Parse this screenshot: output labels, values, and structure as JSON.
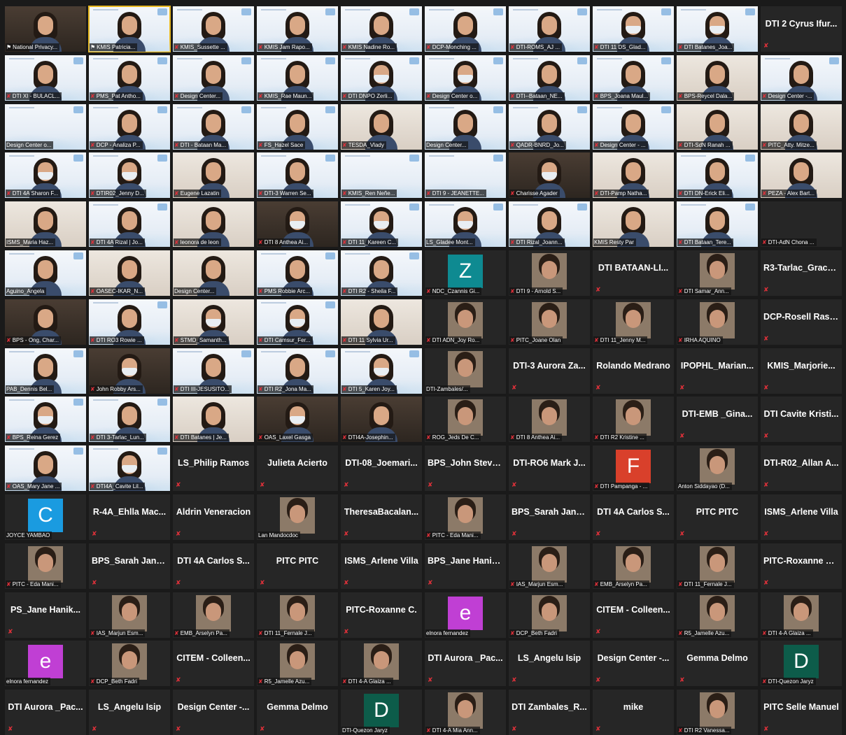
{
  "colors": {
    "background": "#1a1a1a",
    "tile": "#262626",
    "active_speaker": "#e8b820",
    "muted": "#e0313a",
    "tag_text": "#ffffff"
  },
  "icons": {
    "muted": "✘",
    "pinned": "⚑"
  },
  "participants": [
    {
      "name": "National Privacy...",
      "type": "video",
      "pinned": true,
      "muted": false,
      "style": "dark"
    },
    {
      "name": "KMIS Patricia...",
      "type": "video",
      "pinned": true,
      "muted": false,
      "active": true
    },
    {
      "name": "KMIS_Sussette ...",
      "type": "video",
      "muted": true
    },
    {
      "name": "KMIS Jam Rapo...",
      "type": "video",
      "muted": true
    },
    {
      "name": "KMIS Nadine Ro...",
      "type": "video",
      "muted": true
    },
    {
      "name": "DCP-Monching ...",
      "type": "video",
      "muted": true
    },
    {
      "name": "DTI-ROMS_AJ ...",
      "type": "video",
      "muted": true
    },
    {
      "name": "DTI 11 DS_Glad...",
      "type": "video",
      "muted": true,
      "mask": true
    },
    {
      "name": "DTI Batanes_Joa...",
      "type": "video",
      "muted": true,
      "mask": true
    },
    {
      "name": "DTI 2 Cyrus Ifur...",
      "type": "name",
      "muted": true
    },
    {
      "name": "DTI XI - BULACL...",
      "type": "video",
      "muted": true
    },
    {
      "name": "PMS_Pat Antho...",
      "type": "video",
      "muted": true
    },
    {
      "name": "Design Center...",
      "type": "video",
      "muted": true
    },
    {
      "name": "KMIS_Rae Maun...",
      "type": "video",
      "muted": true
    },
    {
      "name": "DTI DNPO Zerli...",
      "type": "video",
      "muted": true,
      "mask": true
    },
    {
      "name": "Design Center o...",
      "type": "video",
      "muted": true,
      "mask": true
    },
    {
      "name": "DTI--Bataan_NE...",
      "type": "video",
      "muted": true
    },
    {
      "name": "BPS_Joana Maul...",
      "type": "video",
      "muted": true
    },
    {
      "name": "BPS-Reycel Dala...",
      "type": "video",
      "muted": true,
      "style": "alt"
    },
    {
      "name": "Design Center -...",
      "type": "video",
      "muted": true
    },
    {
      "name": "Design Center o...",
      "type": "video",
      "muted": false,
      "noperson": true
    },
    {
      "name": "DCP - Analiza P...",
      "type": "video",
      "muted": true
    },
    {
      "name": "DTI - Bataan Ma...",
      "type": "video",
      "muted": true
    },
    {
      "name": "FS_Hazel Sace",
      "type": "video",
      "muted": true
    },
    {
      "name": "TESDA_Vlady",
      "type": "video",
      "muted": true,
      "style": "alt"
    },
    {
      "name": "Design Center...",
      "type": "video",
      "muted": false
    },
    {
      "name": "QADR-BNRD_Jo...",
      "type": "video",
      "muted": true
    },
    {
      "name": "Design Center - ...",
      "type": "video",
      "muted": true
    },
    {
      "name": "DTI-SdN Ranah ...",
      "type": "video",
      "muted": true,
      "style": "alt"
    },
    {
      "name": "PITC_Atty. Mitze...",
      "type": "video",
      "muted": true,
      "style": "alt"
    },
    {
      "name": "DTI 4A Sharon F...",
      "type": "video",
      "muted": true,
      "mask": true
    },
    {
      "name": "DTIR02_Jenny D...",
      "type": "video",
      "muted": true,
      "mask": true
    },
    {
      "name": "Eugene Lazatin",
      "type": "video",
      "muted": true,
      "style": "alt"
    },
    {
      "name": "DTI-3 Warren Se...",
      "type": "video",
      "muted": true
    },
    {
      "name": "KMIS_Ren Neñe...",
      "type": "video",
      "muted": true,
      "noperson": true
    },
    {
      "name": "DTI 9 - JEANETTE...",
      "type": "video",
      "muted": true,
      "noperson": true
    },
    {
      "name": "Charisse Agader",
      "type": "video",
      "muted": true,
      "style": "dark",
      "mask": true
    },
    {
      "name": "DTI-Pamp Natha...",
      "type": "video",
      "muted": true,
      "style": "alt"
    },
    {
      "name": "DTI DN-Erick Eli...",
      "type": "video",
      "muted": true
    },
    {
      "name": "PEZA - Alex Bart...",
      "type": "video",
      "muted": true,
      "style": "alt"
    },
    {
      "name": "ISMS_Maria Haz...",
      "type": "video",
      "muted": false,
      "style": "alt"
    },
    {
      "name": "DTI 4A Rizal | Jo...",
      "type": "video",
      "muted": true
    },
    {
      "name": "leonora de leon",
      "type": "video",
      "muted": true,
      "style": "alt"
    },
    {
      "name": "DTI 8 Anthea Ai...",
      "type": "video",
      "muted": true,
      "style": "dark",
      "mask": true
    },
    {
      "name": "DTI 11_Kareen C...",
      "type": "video",
      "muted": true,
      "mask": true
    },
    {
      "name": "LS_Gladee Mont...",
      "type": "video",
      "muted": false,
      "mask": true
    },
    {
      "name": "DTI Rizal_Joann...",
      "type": "video",
      "muted": true
    },
    {
      "name": "KMIS Resty Par",
      "type": "video",
      "muted": false,
      "style": "alt"
    },
    {
      "name": "DTI Bataan_Tere...",
      "type": "video",
      "muted": true
    },
    {
      "name": "DTI-AdN Chona ...",
      "type": "empty",
      "muted": true
    },
    {
      "name": "Aguino_Angela",
      "type": "video",
      "muted": false
    },
    {
      "name": "OASEC-IKAR_N...",
      "type": "video",
      "muted": true,
      "style": "alt"
    },
    {
      "name": "Design Center...",
      "type": "video",
      "muted": false,
      "style": "alt"
    },
    {
      "name": "PMS Robbie Arc...",
      "type": "video",
      "muted": true
    },
    {
      "name": "DTI R2 - Sheila F...",
      "type": "video",
      "muted": true
    },
    {
      "name": "NDC_Czannis Gi...",
      "type": "avatar",
      "letter": "Z",
      "avatarColor": "#0e8a91",
      "muted": true
    },
    {
      "name": "DTI 9 - Arnold S...",
      "type": "photo",
      "muted": true
    },
    {
      "name": "DTI BATAAN-LI...",
      "type": "name",
      "muted": true
    },
    {
      "name": "DTI Samar_Ann...",
      "type": "photo",
      "muted": true
    },
    {
      "name": "R3-Tarlac_Grace...",
      "type": "name",
      "muted": true
    },
    {
      "name": "BPS - Ong, Char...",
      "type": "video",
      "muted": true,
      "style": "dark"
    },
    {
      "name": "DTI RO3 Rowie ...",
      "type": "video",
      "muted": true
    },
    {
      "name": "STMD_Samanth...",
      "type": "video",
      "muted": true,
      "style": "alt",
      "mask": true
    },
    {
      "name": "DTI Camsur_Fer...",
      "type": "video",
      "muted": true,
      "mask": true
    },
    {
      "name": "DTI 11 Sylvia Ur...",
      "type": "video",
      "muted": true,
      "style": "alt"
    },
    {
      "name": "DTI ADN_Joy Ro...",
      "type": "photo",
      "muted": true
    },
    {
      "name": "PITC_Joane Olan",
      "type": "photo",
      "muted": true
    },
    {
      "name": "DTI 11_Jenny M...",
      "type": "photo",
      "muted": true
    },
    {
      "name": "IRHA AQUINO",
      "type": "photo",
      "muted": true
    },
    {
      "name": "DCP-Rosell Rasos",
      "type": "name",
      "muted": true
    },
    {
      "name": "PAB_Dennis Bel...",
      "type": "video",
      "muted": false
    },
    {
      "name": "John Robby Ars...",
      "type": "video",
      "muted": true,
      "style": "dark",
      "mask": true
    },
    {
      "name": "DTI III-JESUSITO...",
      "type": "video",
      "muted": true
    },
    {
      "name": "DTI R2_Jona Ma...",
      "type": "video",
      "muted": true
    },
    {
      "name": "DTI 5_Karen Joy...",
      "type": "video",
      "muted": true,
      "mask": true
    },
    {
      "name": "DTI-Zambales/...",
      "type": "photo",
      "muted": false
    },
    {
      "name": "DTI-3 Aurora Za...",
      "type": "name",
      "muted": true
    },
    {
      "name": "Rolando Medrano",
      "type": "name",
      "muted": true
    },
    {
      "name": "IPOPHL_Marian...",
      "type": "name",
      "muted": true
    },
    {
      "name": "KMIS_Marjorie...",
      "type": "name",
      "muted": true
    },
    {
      "name": "BPS_Reina Gerez",
      "type": "video",
      "muted": true,
      "mask": true
    },
    {
      "name": "DTI 3-Tarlac_Lun...",
      "type": "video",
      "muted": true
    },
    {
      "name": "DTI Batanes | Je...",
      "type": "video",
      "muted": true,
      "style": "alt"
    },
    {
      "name": "OAS_Laxel Gasga",
      "type": "video",
      "muted": true,
      "style": "dark",
      "mask": true
    },
    {
      "name": "DTI4A-Josephin...",
      "type": "video",
      "muted": true,
      "style": "dark"
    },
    {
      "name": "ROG_Jeds De C...",
      "type": "photo",
      "muted": true
    },
    {
      "name": "DTI 8 Anthea Ai...",
      "type": "photo",
      "muted": true
    },
    {
      "name": "DTI R2 Kristine ...",
      "type": "photo",
      "muted": true
    },
    {
      "name": "DTI-EMB _Gina...",
      "type": "name",
      "muted": true
    },
    {
      "name": "DTI Cavite Kristi...",
      "type": "name",
      "muted": true
    },
    {
      "name": "OAS_Mary Jane ...",
      "type": "video",
      "muted": true
    },
    {
      "name": "DTI4A_Cavite Lil...",
      "type": "video",
      "muted": true,
      "mask": true
    },
    {
      "name": "LS_Philip Ramos",
      "type": "name",
      "muted": true
    },
    {
      "name": "Julieta Acierto",
      "type": "name",
      "muted": true
    },
    {
      "name": "DTI-08_Joemari...",
      "type": "name",
      "muted": true
    },
    {
      "name": "BPS_John Steve...",
      "type": "name",
      "muted": true
    },
    {
      "name": "DTI-RO6 Mark J...",
      "type": "name",
      "muted": true
    },
    {
      "name": "DTI Pampanga - ...",
      "type": "avatar",
      "letter": "F",
      "avatarColor": "#d9402b",
      "muted": true
    },
    {
      "name": "Anton Siddayao (D...",
      "type": "photo",
      "muted": false
    },
    {
      "name": "DTI-R02_Allan A...",
      "type": "name",
      "muted": true
    },
    {
      "name": "JOYCE YAMBAO",
      "type": "avatar",
      "letter": "C",
      "avatarColor": "#1a9be0",
      "muted": false
    },
    {
      "name": "R-4A_Ehlla Mac...",
      "type": "name",
      "muted": true
    },
    {
      "name": "Aldrin Veneracion",
      "type": "name",
      "muted": true
    },
    {
      "name": "Lan Mandocdoc",
      "type": "photo",
      "muted": false
    },
    {
      "name": "TheresaBacalan...",
      "type": "name",
      "muted": true
    },
    {
      "name": "PITC - Eda Mani...",
      "type": "photo",
      "muted": true
    },
    {
      "name": "BPS_Sarah Jane...",
      "type": "name",
      "muted": true
    },
    {
      "name": "DTI 4A Carlos S...",
      "type": "name",
      "muted": true
    },
    {
      "name": "PITC PITC",
      "type": "name",
      "muted": true
    },
    {
      "name": "ISMS_Arlene Villa",
      "type": "name",
      "muted": true
    },
    {
      "name": "PITC - Eda Mani...",
      "type": "photo",
      "muted": true
    },
    {
      "name": "BPS_Sarah Jane...",
      "type": "name",
      "muted": true
    },
    {
      "name": "DTI 4A Carlos S...",
      "type": "name",
      "muted": true
    },
    {
      "name": "PITC PITC",
      "type": "name",
      "muted": true
    },
    {
      "name": "ISMS_Arlene Villa",
      "type": "name",
      "muted": true
    },
    {
      "name": "BPS_Jane Hanik...",
      "type": "name",
      "muted": true
    },
    {
      "name": "IAS_Marjun Esm...",
      "type": "photo",
      "muted": true
    },
    {
      "name": "EMB_Arselyn Pa...",
      "type": "photo",
      "muted": true
    },
    {
      "name": "DTI 11_Fernale J...",
      "type": "photo",
      "muted": true
    },
    {
      "name": "PITC-Roxanne C...",
      "type": "name",
      "muted": true
    },
    {
      "name": "PS_Jane Hanik...",
      "type": "name",
      "muted": true
    },
    {
      "name": "IAS_Marjun Esm...",
      "type": "photo",
      "muted": true
    },
    {
      "name": "EMB_Arselyn Pa...",
      "type": "photo",
      "muted": true
    },
    {
      "name": "DTI 11_Fernale J...",
      "type": "photo",
      "muted": true
    },
    {
      "name": "PITC-Roxanne C.",
      "type": "name",
      "muted": true
    },
    {
      "name": "elnora fernandez",
      "type": "avatar",
      "letter": "e",
      "avatarColor": "#c03fd4",
      "muted": false
    },
    {
      "name": "DCP_Beth Fadri",
      "type": "photo",
      "muted": true
    },
    {
      "name": "CITEM - Colleen...",
      "type": "name",
      "muted": true
    },
    {
      "name": "R5_Jamelle Azu...",
      "type": "photo",
      "muted": true
    },
    {
      "name": "DTI 4-A Glaiza ...",
      "type": "photo",
      "muted": true
    },
    {
      "name": "elnora fernandez",
      "type": "avatar",
      "letter": "e",
      "avatarColor": "#c03fd4",
      "muted": false
    },
    {
      "name": "DCP_Beth Fadri",
      "type": "photo",
      "muted": true
    },
    {
      "name": "CITEM - Colleen...",
      "type": "name",
      "muted": true
    },
    {
      "name": "R5_Jamelle Azu...",
      "type": "photo",
      "muted": true
    },
    {
      "name": "DTI 4-A Glaiza ...",
      "type": "photo",
      "muted": true
    },
    {
      "name": "DTI Aurora _Pac...",
      "type": "name",
      "muted": true
    },
    {
      "name": "LS_Angelu Isip",
      "type": "name",
      "muted": true
    },
    {
      "name": "Design Center -...",
      "type": "name",
      "muted": true
    },
    {
      "name": "Gemma Delmo",
      "type": "name",
      "muted": true
    },
    {
      "name": "DTI-Quezon Jaryz",
      "type": "avatar",
      "letter": "D",
      "avatarColor": "#0d5c4a",
      "muted": true
    },
    {
      "name": "DTI Aurora _Pac...",
      "type": "name",
      "muted": true
    },
    {
      "name": "LS_Angelu Isip",
      "type": "name",
      "muted": true
    },
    {
      "name": "Design Center -...",
      "type": "name",
      "muted": true
    },
    {
      "name": "Gemma Delmo",
      "type": "name",
      "muted": true
    },
    {
      "name": "DTI-Quezon Jaryz",
      "type": "avatar",
      "letter": "D",
      "avatarColor": "#0d5c4a",
      "muted": false
    },
    {
      "name": "DTI 4-A Mia Ann...",
      "type": "photo",
      "muted": true
    },
    {
      "name": "DTI Zambales_R...",
      "type": "name",
      "muted": true
    },
    {
      "name": "mike",
      "type": "name",
      "muted": true
    },
    {
      "name": "DTI R2 Vanessa...",
      "type": "photo",
      "muted": true
    },
    {
      "name": "PITC Selle Manuel",
      "type": "name",
      "muted": true
    }
  ]
}
